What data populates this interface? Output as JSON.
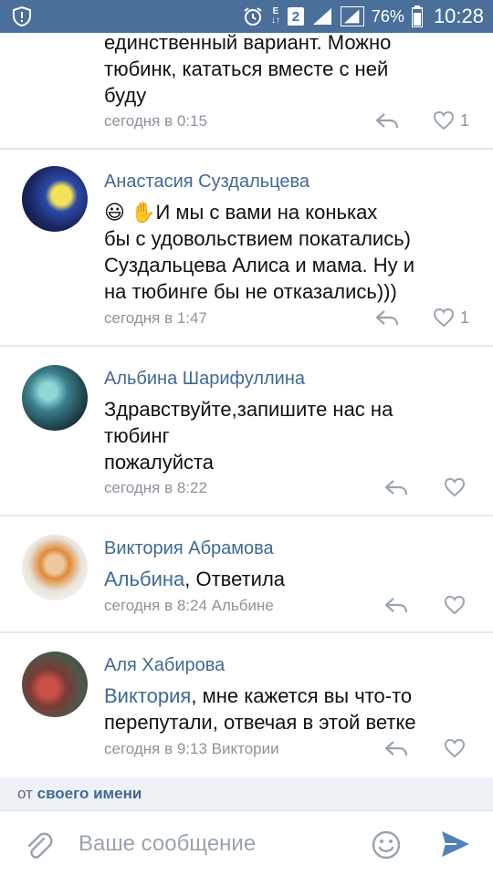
{
  "status_bar": {
    "battery_percent": "76%",
    "time": "10:28",
    "sim_label": "2",
    "network_top": "E",
    "network_bottom": "↓↑"
  },
  "comments": [
    {
      "name": "",
      "text_lines": [
        "единственный вариант. Можно",
        "тюбинк, кататься вместе с ней",
        "буду"
      ],
      "time": "сегодня в 0:15",
      "likes": "1"
    },
    {
      "name": "Анастасия Суздальцева",
      "emoji": "😃 ✋",
      "text_first": "И мы с вами на коньках",
      "text_lines": [
        "бы с удовольствием покатались)",
        "Суздальцева Алиса и мама. Ну и",
        "на тюбинге бы не отказались)))"
      ],
      "time": "сегодня в 1:47",
      "likes": "1"
    },
    {
      "name": "Альбина Шарифуллина",
      "text_lines": [
        "Здравствуйте,запишите нас на",
        "тюбинг",
        "пожалуйста"
      ],
      "time": "сегодня в 8:22",
      "likes": ""
    },
    {
      "name": "Виктория Абрамова",
      "mention": "Альбина",
      "text_after_mention": ", Ответила",
      "time": "сегодня в 8:24 Альбине",
      "likes": ""
    },
    {
      "name": "Аля Хабирова",
      "mention": "Виктория",
      "text_after_mention": ", мне кажется вы что-то",
      "text_lines": [
        "перепутали, отвечая в этой ветке"
      ],
      "time": "сегодня в 9:13 Виктории",
      "likes": ""
    }
  ],
  "from_bar": {
    "prefix": "от",
    "link": "своего имени"
  },
  "composer": {
    "placeholder": "Ваше сообщение"
  },
  "colors": {
    "status_bar": "#4a6f9a",
    "accent": "#3f6a96",
    "meta": "#8c939b",
    "divider": "#e6e9ed"
  },
  "icons": [
    "shield-alert-icon",
    "alarm-icon",
    "signal-icon",
    "battery-icon",
    "reply-icon",
    "heart-icon",
    "paperclip-icon",
    "smile-icon",
    "send-icon"
  ]
}
